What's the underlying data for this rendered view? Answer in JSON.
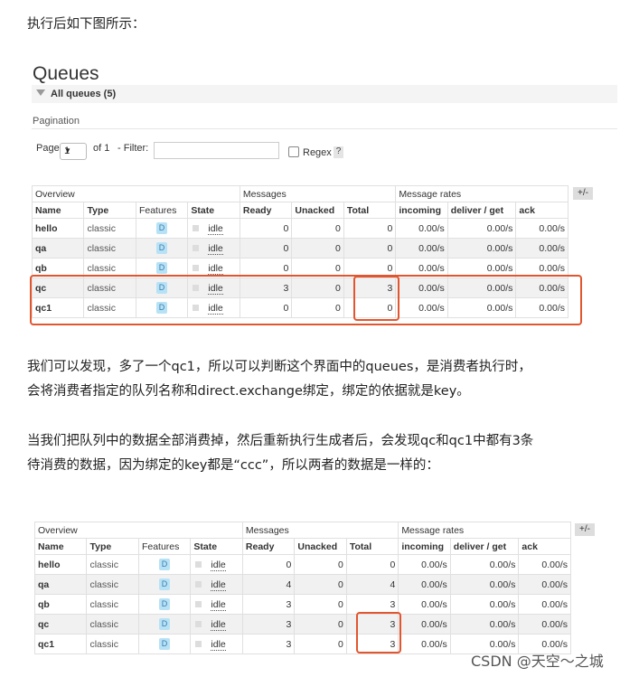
{
  "intro": "执行后如下图所示：",
  "screen1": {
    "title": "Queues",
    "all_queues": "All queues (5)",
    "pagination_label": "Pagination",
    "page_label": "Page",
    "page_value": "1",
    "of_label": "of 1",
    "filter_label": "- Filter:",
    "regex_label": "Regex",
    "help": "?",
    "plusminus": "+/-",
    "groups": {
      "overview": "Overview",
      "messages": "Messages",
      "rates": "Message rates"
    },
    "columns": [
      "Name",
      "Type",
      "Features",
      "State",
      "Ready",
      "Unacked",
      "Total",
      "incoming",
      "deliver / get",
      "ack"
    ],
    "rows": [
      {
        "name": "hello",
        "type": "classic",
        "feature": "D",
        "state": "idle",
        "ready": "0",
        "unacked": "0",
        "total": "0",
        "incoming": "0.00/s",
        "deliver": "0.00/s",
        "ack": "0.00/s"
      },
      {
        "name": "qa",
        "type": "classic",
        "feature": "D",
        "state": "idle",
        "ready": "0",
        "unacked": "0",
        "total": "0",
        "incoming": "0.00/s",
        "deliver": "0.00/s",
        "ack": "0.00/s"
      },
      {
        "name": "qb",
        "type": "classic",
        "feature": "D",
        "state": "idle",
        "ready": "0",
        "unacked": "0",
        "total": "0",
        "incoming": "0.00/s",
        "deliver": "0.00/s",
        "ack": "0.00/s"
      },
      {
        "name": "qc",
        "type": "classic",
        "feature": "D",
        "state": "idle",
        "ready": "3",
        "unacked": "0",
        "total": "3",
        "incoming": "0.00/s",
        "deliver": "0.00/s",
        "ack": "0.00/s"
      },
      {
        "name": "qc1",
        "type": "classic",
        "feature": "D",
        "state": "idle",
        "ready": "0",
        "unacked": "0",
        "total": "0",
        "incoming": "0.00/s",
        "deliver": "0.00/s",
        "ack": "0.00/s"
      }
    ]
  },
  "para2_line1": "我们可以发现，多了一个qc1，所以可以判断这个界面中的queues，是消费者执行时，",
  "para2_line2": "会将消费者指定的队列名称和direct.exchange绑定，绑定的依据就是key。",
  "para3_line1": "当我们把队列中的数据全部消费掉，然后重新执行生成者后，会发现qc和qc1中都有3条",
  "para3_line2": "待消费的数据，因为绑定的key都是“ccc”，所以两者的数据是一样的：",
  "screen2": {
    "plusminus": "+/-",
    "groups": {
      "overview": "Overview",
      "messages": "Messages",
      "rates": "Message rates"
    },
    "columns": [
      "Name",
      "Type",
      "Features",
      "State",
      "Ready",
      "Unacked",
      "Total",
      "incoming",
      "deliver / get",
      "ack"
    ],
    "rows": [
      {
        "name": "hello",
        "type": "classic",
        "feature": "D",
        "state": "idle",
        "ready": "0",
        "unacked": "0",
        "total": "0",
        "incoming": "0.00/s",
        "deliver": "0.00/s",
        "ack": "0.00/s"
      },
      {
        "name": "qa",
        "type": "classic",
        "feature": "D",
        "state": "idle",
        "ready": "4",
        "unacked": "0",
        "total": "4",
        "incoming": "0.00/s",
        "deliver": "0.00/s",
        "ack": "0.00/s"
      },
      {
        "name": "qb",
        "type": "classic",
        "feature": "D",
        "state": "idle",
        "ready": "3",
        "unacked": "0",
        "total": "3",
        "incoming": "0.00/s",
        "deliver": "0.00/s",
        "ack": "0.00/s"
      },
      {
        "name": "qc",
        "type": "classic",
        "feature": "D",
        "state": "idle",
        "ready": "3",
        "unacked": "0",
        "total": "3",
        "incoming": "0.00/s",
        "deliver": "0.00/s",
        "ack": "0.00/s"
      },
      {
        "name": "qc1",
        "type": "classic",
        "feature": "D",
        "state": "idle",
        "ready": "3",
        "unacked": "0",
        "total": "3",
        "incoming": "0.00/s",
        "deliver": "0.00/s",
        "ack": "0.00/s"
      }
    ]
  },
  "watermark": "CSDN @天空～之城",
  "highlight_color": "#e2562f"
}
